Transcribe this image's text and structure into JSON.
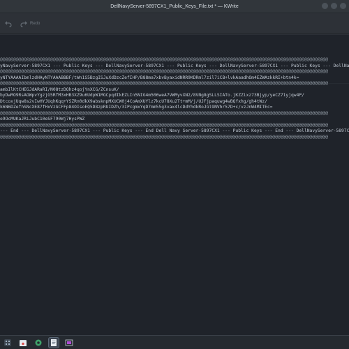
{
  "window": {
    "title": "DellNavyServer-5897CX1_Public_Keys_File.txt * — KWrite"
  },
  "toolbar": {
    "redo_label": "Redo"
  },
  "editor": {
    "lines": [
      "@@@@@@@@@@@@@@@@@@@@@@@@@@@@@@@@@@@@@@@@@@@@@@@@@@@@@@@@@@@@@@@@@@@@@@@@@@@@@@@@@@@@@@@@@@@@@@@@@@@@@@@@@@@@@@@@@@@@@@@@@@@@",
      "yNavyServer-5897CX1 --- Public Keys --- DellNavyServer-5897CX1 --- Public Keys --- DellNavyServer-5897CX1 --- Public Keys --- DellNavyServer-5897CX1",
      "@@@@@@@@@@@@@@@@@@@@@@@@@@@@@@@@@@@@@@@@@@@@@@@@@@@@@@@@@@@@@@@@@@@@@@@@@@@@@@@@@@@@@@@@@@@@@@@@@@@@@@@@@@@@@@@@@@@@@@@@@@@@",
      "yNTYAAAAIbmlzdHAyNTYAAABBBF/tWn1S5BzgISJuXdDzcZefIHP/B88ma7xbvByaxidNRR9KDRml7zil7iCB+lvkAaadhOm4EZWAzkkRI+btn4k=",
      "@@@@@@@@@@@@@@@@@@@@@@@@@@@@@@@@@@@@@@@@@@@@@@@@@@@@@@@@@@@@@@@@@@@@@@@@@@@@@@@@@@@@@@@@@@@@@@@@@@@@@@@@@@@@@@@@@@@@@@@@@@@@",
      "ambIlKtCHEGJdARaRI/N08tzDQhz4qojYnXCG/ZCnsuK/",
      "byDwMO9RsAOWpvYgzjG5RfM3xHB3XZ9u6UdpW1MGCpqdIkEZLIn5NIG4m506weA7VWMyvXN2/8VNg8gSLLSIATo.jKZZixz73Bjyp/yeCZ71yjqw4P/",
      "DtcoxjUqw8s2vIwHYJUqhKqq+YSZRn0dkX9absknpMXUCW0j4CoAmXUYlz7kcU78Xu2Tt+mM/j/UJFjpaquwg4wBQfxhg/gh4tWz/",
      "k6N6DZefhSNcXE87fHxVzGCFFp84OIsoEQ5D8zpRUIDZh/3IPcgmxYqD7mm55g3vax4lcDdYhdkRoJGl9NVhr57D+c/vzJnW4MITEc=",
      "@@@@@@@@@@@@@@@@@@@@@@@@@@@@@@@@@@@@@@@@@@@@@@@@@@@@@@@@@@@@@@@@@@@@@@@@@@@@@@@@@@@@@@@@@@@@@@@@@@@@@@@@@@@@@@@@@@@@@@@@@@@@",
      "o9OcMUKaJRiJubC10eSF790Wj7HysPWZ",
      "@@@@@@@@@@@@@@@@@@@@@@@@@@@@@@@@@@@@@@@@@@@@@@@@@@@@@@@@@@@@@@@@@@@@@@@@@@@@@@@@@@@@@@@@@@@@@@@@@@@@@@@@@@@@@@@@@@@@@@@@@@@@",
      "--- End --- DellNavyServer-5897CX1 --- Public Keys --- End Dell Navy Server-5897CX1 --- Public Keys --- End --- DellNavyServer-5897CX1 ---",
      "@@@@@@@@@@@@@@@@@@@@@@@@@@@@@@@@@@@@@@@@@@@@@@@@@@@@@@@@@@@@@@@@@@@@@@@@@@@@@@@@@@@@@@@@@@@@@@@@@@@@@@@@@@@@@@@@@@@@@@@@@@@@"
    ]
  },
  "taskbar": {
    "items": [
      "app-launcher-icon",
      "file-manager-icon",
      "settings-icon",
      "kwrite-icon",
      "screenshot-icon"
    ]
  },
  "colors": {
    "window_bg": "#1f232a",
    "titlebar": "#31363b",
    "taskbar": "#252a30",
    "text": "#c0c8d2"
  }
}
